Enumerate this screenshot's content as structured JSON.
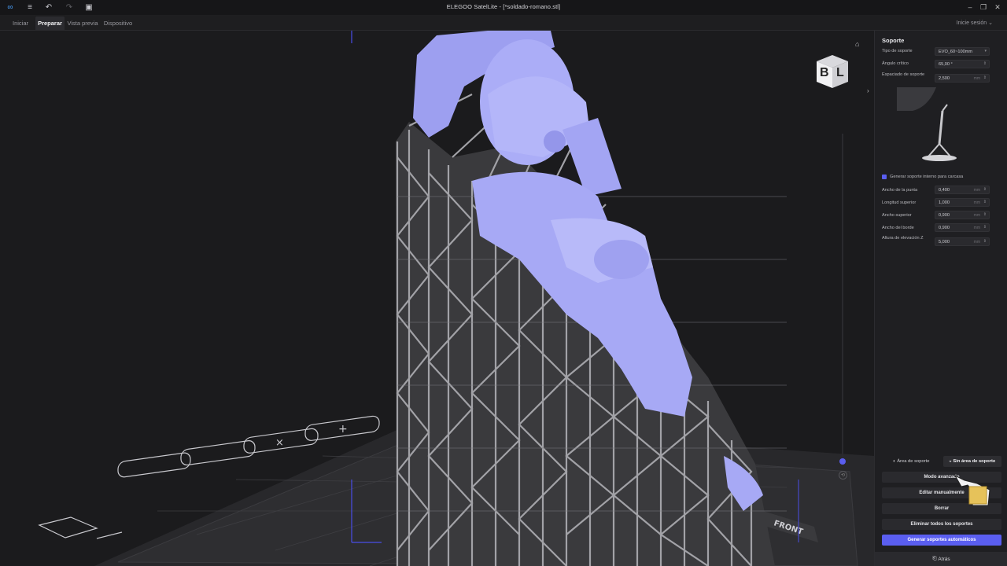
{
  "window": {
    "title": "ELEGOO SatelLite - [*soldado-romano.stl]",
    "controls": [
      "minimize-icon",
      "restore-icon",
      "close-icon"
    ]
  },
  "toolbar": {
    "icons": [
      "app-logo-icon",
      "menu-icon",
      "undo-icon",
      "redo-icon",
      "save-icon"
    ]
  },
  "tabs": [
    {
      "label": "Iniciar",
      "active": false
    },
    {
      "label": "Preparar",
      "active": true
    },
    {
      "label": "Vista previa",
      "active": false
    },
    {
      "label": "Dispositivo",
      "active": false
    }
  ],
  "login_label": "Inicie sesión",
  "viewcube": {
    "left_face": "B",
    "right_face": "L"
  },
  "viewport": {
    "plate_label": "FRONT",
    "colors": {
      "model": "#a9acf6",
      "supports": "#8e8e93",
      "plate": "#2a2a2d",
      "accent": "#5a5ef0"
    }
  },
  "panel": {
    "title": "Soporte",
    "rows_top": [
      {
        "label": "Tipo de soporte",
        "value": "EVO_60~100mm",
        "unit": "",
        "kind": "dropdown"
      },
      {
        "label": "Ángulo crítico",
        "value": "65,00 °",
        "unit": "",
        "kind": "spin"
      },
      {
        "label": "Espaciado de soporte",
        "value": "2,500",
        "unit": "mm",
        "kind": "spin"
      }
    ],
    "checkbox_label": "Generar soporte interno para carcasa",
    "rows_bottom": [
      {
        "label": "Ancho de la punta",
        "value": "0,400",
        "unit": "mm"
      },
      {
        "label": "Longitud superior",
        "value": "1,000",
        "unit": "mm"
      },
      {
        "label": "Ancho superior",
        "value": "0,900",
        "unit": "mm"
      },
      {
        "label": "Ancho del borde",
        "value": "0,900",
        "unit": "mm"
      },
      {
        "label": "Altura de elevación Z",
        "value": "5,000",
        "unit": "mm"
      }
    ],
    "toggle_area": "Área de soporte",
    "toggle_no_area": "Sin área de soporte",
    "buttons": {
      "advanced": "Modo avanzado",
      "manual": "Editar manualmente",
      "delete": "Borrar",
      "delete_all": "Eliminar todos los soportes",
      "generate": "Generar soportes automáticos"
    },
    "footer": "Atrás"
  }
}
